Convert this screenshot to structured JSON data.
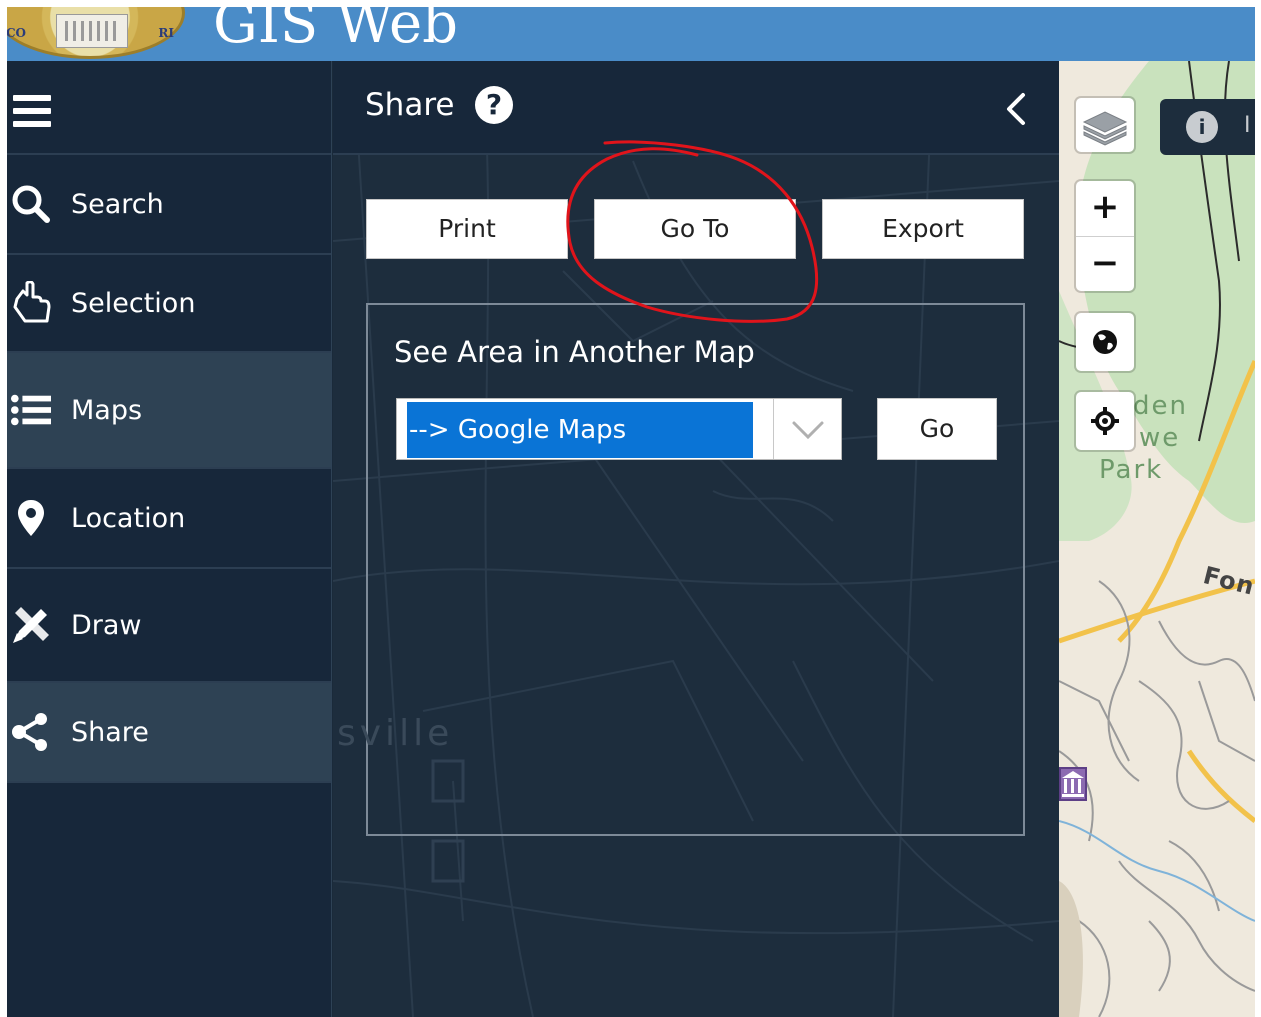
{
  "app": {
    "title": "GIS Web"
  },
  "sidebar": {
    "items": [
      {
        "label": "Search",
        "icon": "search-icon"
      },
      {
        "label": "Selection",
        "icon": "pointer-hand-icon"
      },
      {
        "label": "Maps",
        "icon": "list-icon"
      },
      {
        "label": "Location",
        "icon": "map-pin-icon"
      },
      {
        "label": "Draw",
        "icon": "pencil-ruler-icon"
      },
      {
        "label": "Share",
        "icon": "share-icon"
      }
    ]
  },
  "panel": {
    "title": "Share",
    "tabs": [
      "Print",
      "Go To",
      "Export"
    ],
    "section_title": "See Area in Another Map",
    "map_select_value": "--> Google Maps",
    "go_label": "Go"
  },
  "map": {
    "labels": {
      "park_line1": "den",
      "park_line2": "we",
      "park_line3": "Park",
      "road": "Fon",
      "town": "sville"
    },
    "info_text": "I",
    "colors": {
      "park_green": "#c9e2bd",
      "road_yellow": "#f2c24a",
      "header_blue": "#4a8cc8",
      "select_blue": "#0a74d6",
      "annotation_red": "#e0141b"
    }
  }
}
